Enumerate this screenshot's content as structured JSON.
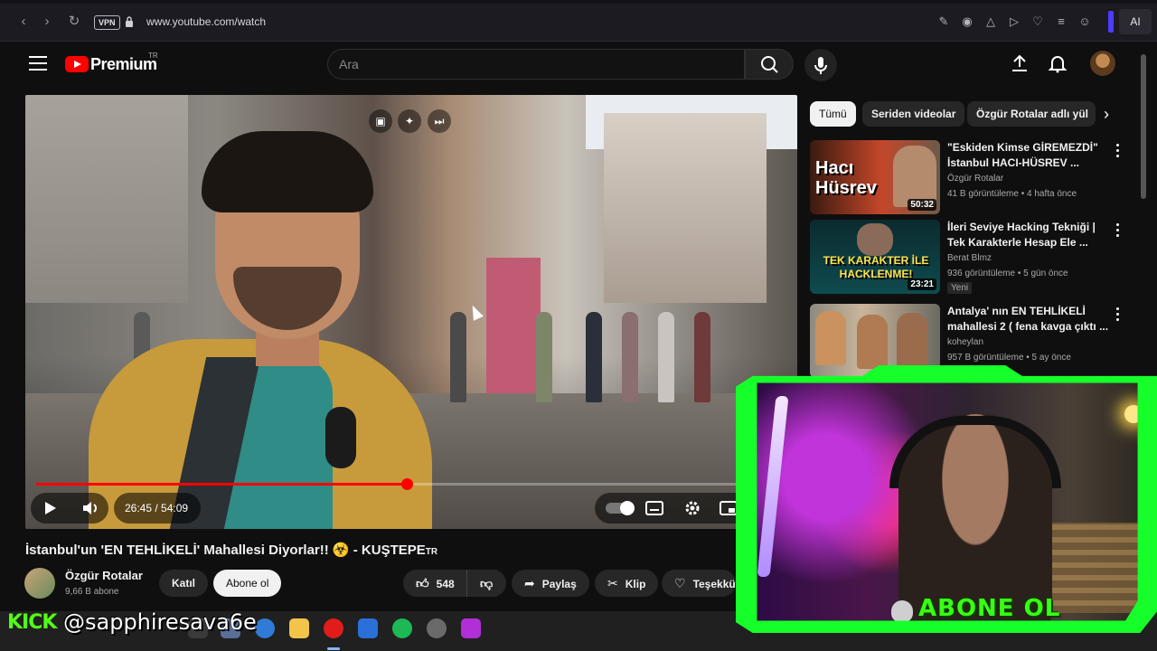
{
  "browser": {
    "url": "www.youtube.com/watch",
    "vpn_label": "VPN",
    "ai_label": "AI"
  },
  "header": {
    "logo_text": "Premium",
    "logo_region": "TR",
    "search_placeholder": "Ara"
  },
  "player": {
    "current_time": "26:45",
    "duration": "54:09",
    "time_display": "26:45 / 54:09",
    "progress": 0.494
  },
  "video": {
    "title": "İstanbul'un 'EN TEHLİKELİ' Mahallesi Diyorlar!! ☣️ - KUŞTEPE",
    "title_suffix": "TR",
    "channel": "Özgür Rotalar",
    "subscribers": "9,66 B abone",
    "join_label": "Katıl",
    "subscribe_label": "Abone ol",
    "like_count": "548",
    "share_label": "Paylaş",
    "clip_label": "Klip",
    "thanks_label": "Teşekkü"
  },
  "chips": [
    {
      "label": "Tümü",
      "active": true
    },
    {
      "label": "Seriden videolar",
      "active": false
    },
    {
      "label": "Özgür Rotalar adlı yül",
      "active": false
    }
  ],
  "recommendations": [
    {
      "title": "\"Eskiden Kimse GİREMEZDİ\" İstanbul HACI-HÜSREV ...",
      "channel": "Özgür Rotalar",
      "meta": "41 B görüntüleme • 4 hafta önce",
      "duration": "50:32",
      "thumb_text": "Hacı Hüsrev",
      "badge": ""
    },
    {
      "title": "İleri Seviye Hacking Tekniği | Tek Karakterle Hesap Ele ...",
      "channel": "Berat Blmz",
      "meta": "936 görüntüleme • 5 gün önce",
      "duration": "23:21",
      "thumb_text": "TEK KARAKTER İLE HACKLENME!",
      "badge": "Yeni"
    },
    {
      "title": "Antalya' nın EN TEHLİKELİ mahallesi 2 ( fena kavga çıktı ...",
      "channel": "koheylan",
      "meta": "957 B görüntüleme • 5 ay önce",
      "duration": "",
      "thumb_text": "",
      "badge": ""
    }
  ],
  "overlay": {
    "cam_text": "ABONE OL",
    "kick_label": "KICK",
    "handle": "@sapphiresava6e"
  },
  "colors": {
    "yt_red": "#ff0000",
    "bg": "#0f0f0f",
    "neon_green": "#39ff14",
    "kick_green": "#53fc18"
  }
}
